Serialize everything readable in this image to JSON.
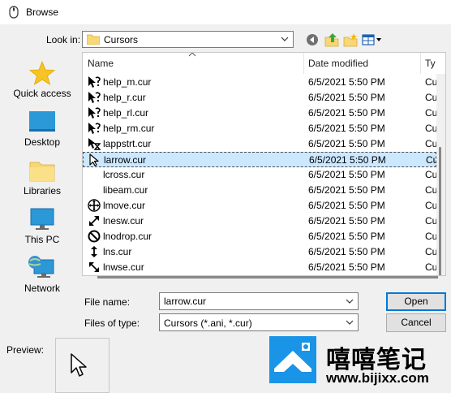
{
  "window": {
    "title": "Browse"
  },
  "toolbar": {
    "look_in_label": "Look in:",
    "look_in_value": "Cursors",
    "buttons": [
      "back-icon",
      "up-folder-icon",
      "new-folder-icon",
      "view-menu-icon"
    ]
  },
  "places": [
    {
      "label": "Quick access",
      "icon": "star-icon"
    },
    {
      "label": "Desktop",
      "icon": "desktop-icon"
    },
    {
      "label": "Libraries",
      "icon": "libraries-icon"
    },
    {
      "label": "This PC",
      "icon": "this-pc-icon"
    },
    {
      "label": "Network",
      "icon": "network-icon"
    }
  ],
  "columns": {
    "name": "Name",
    "date": "Date modified",
    "type": "Ty"
  },
  "files": [
    {
      "name": "help_m.cur",
      "date": "6/5/2021 5:50 PM",
      "type": "Cu",
      "icon": "help-cursor-icon"
    },
    {
      "name": "help_r.cur",
      "date": "6/5/2021 5:50 PM",
      "type": "Cu",
      "icon": "help-cursor-icon"
    },
    {
      "name": "help_rl.cur",
      "date": "6/5/2021 5:50 PM",
      "type": "Cu",
      "icon": "help-cursor-icon"
    },
    {
      "name": "help_rm.cur",
      "date": "6/5/2021 5:50 PM",
      "type": "Cu",
      "icon": "help-cursor-icon"
    },
    {
      "name": "lappstrt.cur",
      "date": "6/5/2021 5:50 PM",
      "type": "Cu",
      "icon": "app-starting-cursor-icon"
    },
    {
      "name": "larrow.cur",
      "date": "6/5/2021 5:50 PM",
      "type": "Cu",
      "icon": "arrow-cursor-icon",
      "selected": true
    },
    {
      "name": "lcross.cur",
      "date": "6/5/2021 5:50 PM",
      "type": "Cu",
      "icon": ""
    },
    {
      "name": "libeam.cur",
      "date": "6/5/2021 5:50 PM",
      "type": "Cu",
      "icon": ""
    },
    {
      "name": "lmove.cur",
      "date": "6/5/2021 5:50 PM",
      "type": "Cu",
      "icon": "move-cursor-icon"
    },
    {
      "name": "lnesw.cur",
      "date": "6/5/2021 5:50 PM",
      "type": "Cu",
      "icon": "resize-nesw-cursor-icon"
    },
    {
      "name": "lnodrop.cur",
      "date": "6/5/2021 5:50 PM",
      "type": "Cu",
      "icon": "no-drop-cursor-icon"
    },
    {
      "name": "lns.cur",
      "date": "6/5/2021 5:50 PM",
      "type": "Cu",
      "icon": "resize-ns-cursor-icon"
    },
    {
      "name": "lnwse.cur",
      "date": "6/5/2021 5:50 PM",
      "type": "Cu",
      "icon": "resize-nwse-cursor-icon"
    }
  ],
  "form": {
    "file_name_label": "File name:",
    "file_name_value": "larrow.cur",
    "file_type_label": "Files of type:",
    "file_type_value": "Cursors (*.ani, *.cur)",
    "open_label": "Open",
    "cancel_label": "Cancel"
  },
  "preview": {
    "label": "Preview:"
  },
  "watermark": {
    "chinese": "嘻嘻笔记",
    "url": "www.bijixx.com"
  },
  "colors": {
    "selection": "#cce8ff",
    "accent": "#0078d7",
    "watermark_blue": "#1a94e6"
  }
}
